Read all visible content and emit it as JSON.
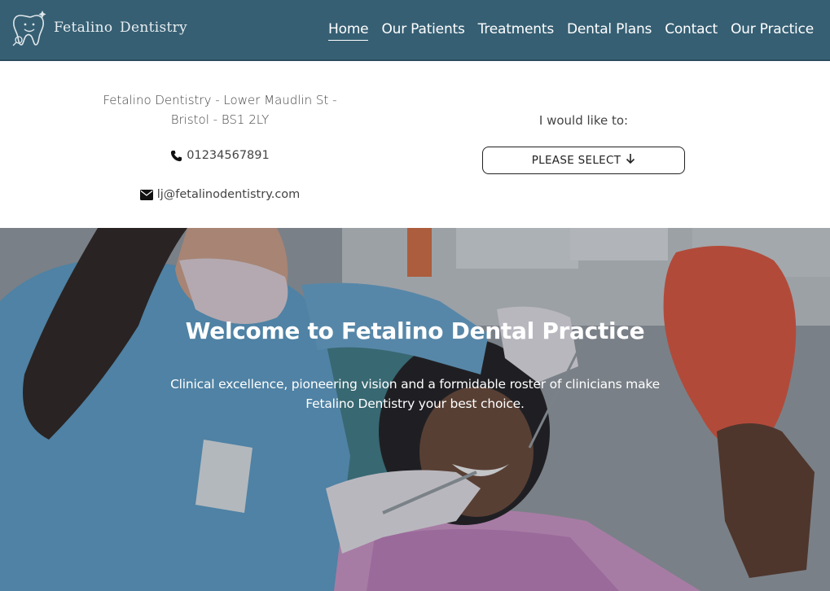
{
  "brand": {
    "name": "Fetalino Dentistry",
    "logo_icon": "tooth-logo-icon"
  },
  "nav": {
    "items": [
      {
        "label": "Home",
        "active": true
      },
      {
        "label": "Our Patients",
        "active": false
      },
      {
        "label": "Treatments",
        "active": false
      },
      {
        "label": "Dental Plans",
        "active": false
      },
      {
        "label": "Contact",
        "active": false
      },
      {
        "label": "Our Practice",
        "active": false
      }
    ]
  },
  "contact": {
    "address_line1": "Fetalino Dentistry - Lower Maudlin St -",
    "address_line2": "Bristol - BS1 2LY",
    "phone": "01234567891",
    "phone_icon": "phone-icon",
    "email": "lj@fetalinodentistry.com",
    "email_icon": "envelope-icon"
  },
  "cta": {
    "prompt": "I would like to:",
    "select_label": "PLEASE SELECT",
    "select_icon": "arrow-down-icon"
  },
  "hero": {
    "title": "Welcome to Fetalino Dental Practice",
    "subtitle_line1": "Clinical excellence, pioneering vision and a formidable roster of clinicians make",
    "subtitle_line2": "Fetalino Dentistry your best choice."
  },
  "colors": {
    "navbar_bg": "#365f73",
    "nav_text": "#ffffff",
    "body_text": "#444444",
    "button_border": "#222222"
  }
}
